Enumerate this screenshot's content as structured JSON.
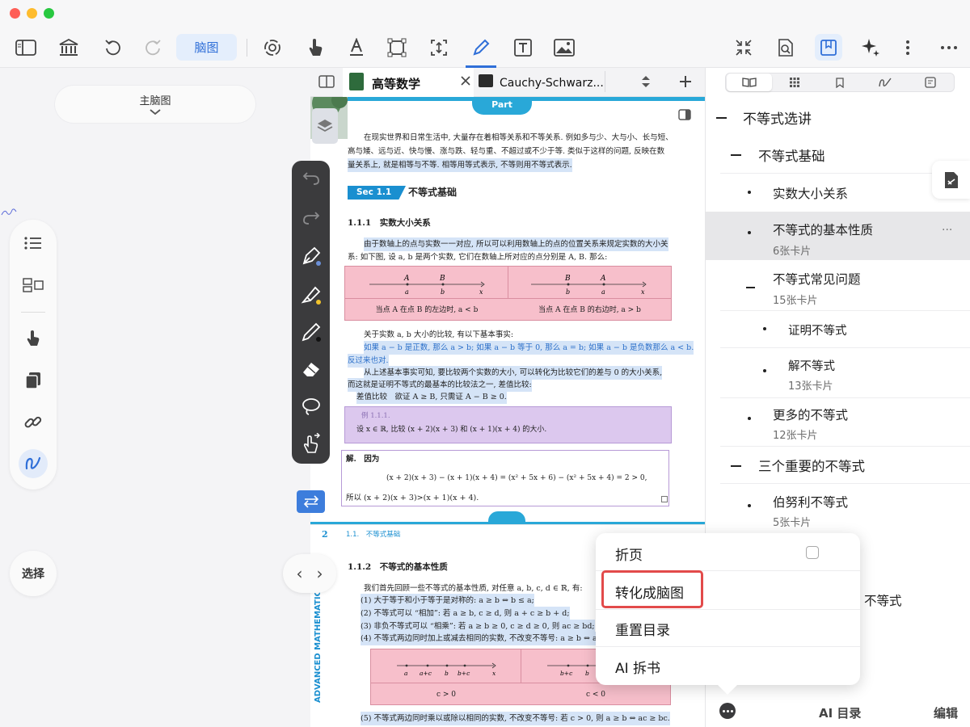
{
  "toolbar": {
    "mindmap_label": "脑图"
  },
  "left": {
    "main_map_label": "主脑图",
    "select_label": "选择"
  },
  "tabs": [
    {
      "label": "高等数学"
    },
    {
      "label": "Cauchy-Schwarz..."
    }
  ],
  "doc": {
    "part_badge": "Part",
    "para1_l1": "在现实世界和日常生活中, 大量存在着相等关系和不等关系. 例如多与少、大与小、长与短、",
    "para1_l2": "高与矮、远与近、快与慢、涨与跌、轻与重、不超过或不少于等. 类似于这样的问题, 反映在数",
    "para1_l3": "量关系上, 就是相等与不等. 相等用等式表示, 不等则用不等式表示.",
    "sec_badge": "Sec 1.1",
    "sec_title": "不等式基础",
    "sub1": "1.1.1　实数大小关系",
    "p2_l1": "由于数轴上的点与实数一一对应, 所以可以利用数轴上的点的位置关系来规定实数的大小关",
    "p2_l2": "系: 如下图, 设 a, b 是两个实数, 它们在数轴上所对应的点分别是 A, B. 那么:",
    "fig1_left": "当点 A 在点 B 的左边时, a < b",
    "fig1_right": "当点 A 在点 B 的右边时, a > b",
    "p3_l1": "关于实数 a, b 大小的比较, 有以下基本事实:",
    "p3_l2": "如果 a − b 是正数, 那么 a > b; 如果 a − b 等于 0, 那么 a = b; 如果 a − b 是负数那么 a < b.",
    "p3_l3": "反过来也对.",
    "p4_l1": "从上述基本事实可知, 要比较两个实数的大小, 可以转化为比较它们的差与 0 的大小关系,",
    "p4_l2": "而这就是证明不等式的最基本的比较法之一, 差值比较:",
    "p4_l3": "差值比较　欲证 A ≥ B, 只需证 A − B ≥ 0.",
    "ex_label": "例 1.1.1.",
    "ex_text": "设 x ∈ ℝ, 比较 (x + 2)(x + 3) 和 (x + 1)(x + 4) 的大小.",
    "sol_label": "解.　因为",
    "sol_eq": "(x + 2)(x + 3) − (x + 1)(x + 4) = (x² + 5x + 6) − (x² + 5x + 4) = 2 > 0,",
    "sol_end": "所以 (x + 2)(x + 3)>(x + 1)(x + 4).",
    "page_num": "2",
    "page_header": "1.1.　不等式基础",
    "side_text": "ADVANCED MATHEMATICS",
    "sub2": "1.1.2　不等式的基本性质",
    "p5_l1": "我们首先回顾一些不等式的基本性质, 对任意 a, b, c, d ∈ ℝ, 有:",
    "p5_l2": "(1) 大于等于和小于等于是对称的: a ≥ b ⇔ b ≤ a;",
    "p5_l3": "(2) 不等式可以 “相加”: 若 a ≥ b, c ≥ d, 则 a + c ≥ b + d;",
    "p5_l4": "(3) 非负不等式可以 “相乘”: 若 a ≥ b ≥ 0, c ≥ d ≥ 0, 则 ac ≥ bd;",
    "p5_l5": "(4) 不等式两边同时加上或减去相同的实数, 不改变不等号: a ≥ b ⇔ a",
    "fig2_left": "c > 0",
    "fig2_right": "c < 0",
    "p6": "(5) 不等式两边同时乘以或除以相同的实数, 不改变不等号: 若 c > 0, 则 a ≥ b ⇔ ac ≥ bc."
  },
  "outline": {
    "items": [
      {
        "title": "不等式选讲"
      },
      {
        "title": "不等式基础"
      },
      {
        "title": "实数大小关系"
      },
      {
        "title": "不等式的基本性质",
        "sub": "6张卡片"
      },
      {
        "title": "不等式常见问题",
        "sub": "15张卡片"
      },
      {
        "title": "证明不等式"
      },
      {
        "title": "解不等式",
        "sub": "13张卡片"
      },
      {
        "title": "更多的不等式",
        "sub": "12张卡片"
      },
      {
        "title": "三个重要的不等式"
      },
      {
        "title": "伯努利不等式",
        "sub": "5张卡片"
      },
      {
        "title": "不等式"
      }
    ],
    "more_label": "···"
  },
  "menu": {
    "items": [
      {
        "label": "折页"
      },
      {
        "label": "转化成脑图"
      },
      {
        "label": "重置目录"
      },
      {
        "label": "AI 拆书"
      }
    ]
  },
  "bottom": {
    "ai_toc_label": "AI 目录",
    "edit_label": "编辑"
  },
  "colors": {
    "accent": "#2f6fd8",
    "highlight": "#d5e4f7",
    "pink": "#f7bfcb",
    "menu_highlight_border": "#e24a4a"
  }
}
